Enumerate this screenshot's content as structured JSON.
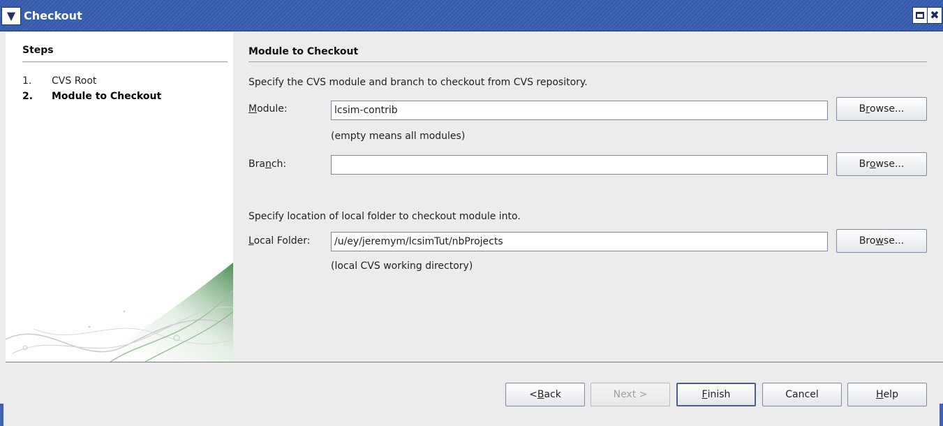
{
  "window": {
    "title": "Checkout"
  },
  "steps": {
    "heading": "Steps",
    "items": [
      {
        "num": "1.",
        "label": "CVS Root",
        "active": false
      },
      {
        "num": "2.",
        "label": "Module to Checkout",
        "active": true
      }
    ]
  },
  "main": {
    "section_title": "Module to Checkout",
    "intro": "Specify the CVS module and branch to checkout from CVS repository.",
    "module": {
      "label_prefix": "",
      "label_mnemonic": "M",
      "label_suffix": "odule:",
      "value": "lcsim-contrib",
      "hint": "(empty means all modules)",
      "browse": {
        "pre": "B",
        "mnemonic": "r",
        "post": "owse..."
      }
    },
    "branch": {
      "label_prefix": "Bra",
      "label_mnemonic": "n",
      "label_suffix": "ch:",
      "value": "",
      "browse": {
        "pre": "Br",
        "mnemonic": "o",
        "post": "wse..."
      }
    },
    "local_intro": "Specify location of local folder to checkout module into.",
    "local_folder": {
      "label_prefix": "",
      "label_mnemonic": "L",
      "label_suffix": "ocal Folder:",
      "value": "/u/ey/jeremym/lcsimTut/nbProjects",
      "hint": "(local CVS working directory)",
      "browse": {
        "pre": "Bro",
        "mnemonic": "w",
        "post": "se..."
      }
    }
  },
  "footer": {
    "back": {
      "pre": "< ",
      "mnemonic": "B",
      "post": "ack"
    },
    "next": "Next >",
    "finish": {
      "pre": "",
      "mnemonic": "F",
      "post": "inish"
    },
    "cancel": "Cancel",
    "help": {
      "pre": "",
      "mnemonic": "H",
      "post": "elp"
    }
  },
  "colors": {
    "titlebar": "#3e63b3",
    "dialog_bg": "#ececec",
    "watermark_green": "#5a9a5a"
  }
}
